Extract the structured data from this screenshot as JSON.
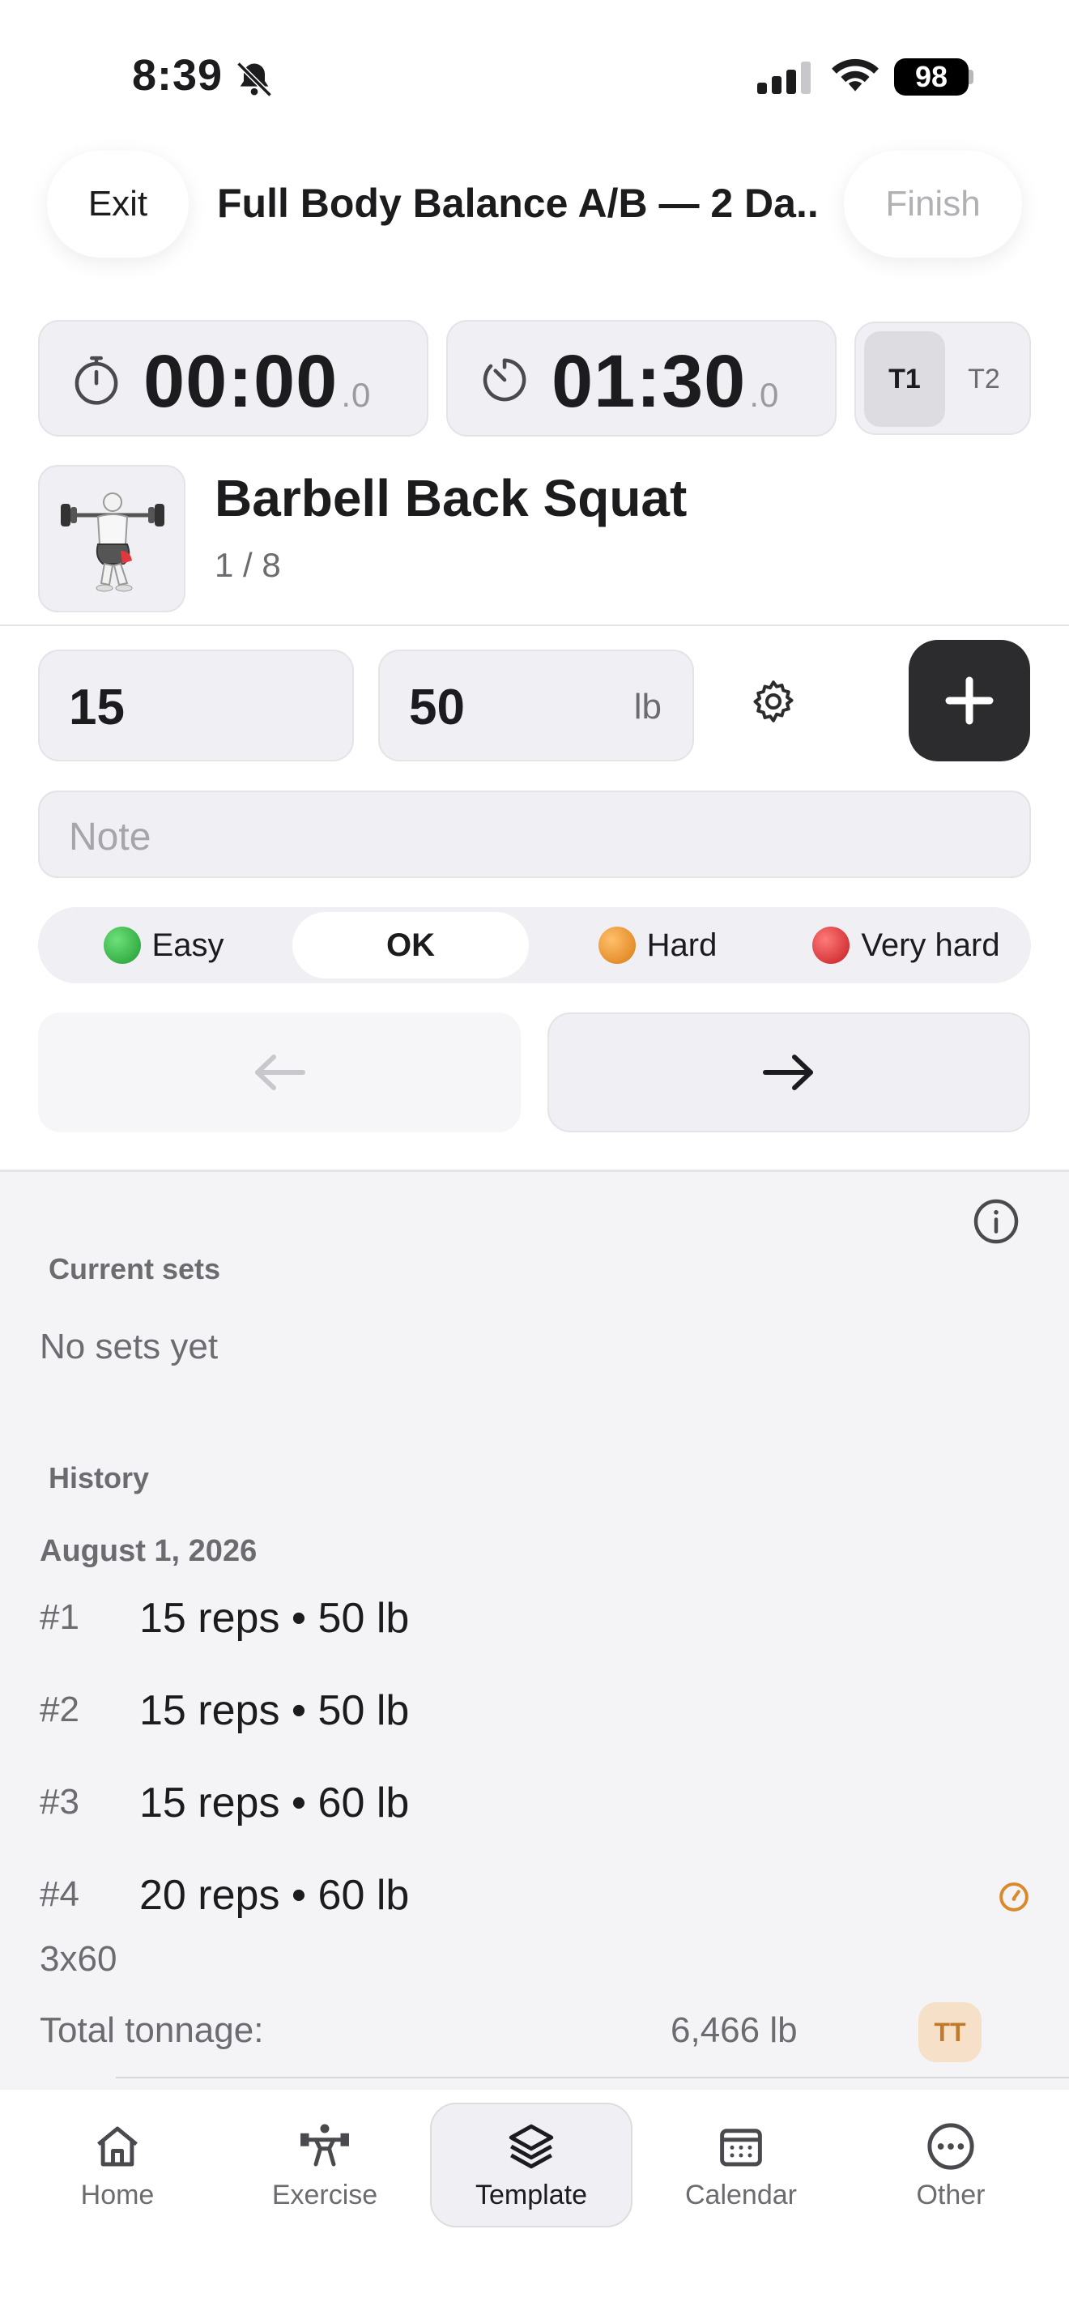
{
  "status": {
    "time": "8:39",
    "battery": "98"
  },
  "header": {
    "exit_label": "Exit",
    "title": "Full Body Balance A/B — 2 Da...",
    "finish_label": "Finish"
  },
  "timers": {
    "elapsed_main": "00:00",
    "elapsed_frac": ".0",
    "rest_main": "01:30",
    "rest_frac": ".0",
    "tabs": [
      "T1",
      "T2"
    ],
    "active_tab": "T1"
  },
  "exercise": {
    "name": "Barbell Back Squat",
    "progress": "1 / 8",
    "icon": "squat-figure-icon"
  },
  "inputs": {
    "reps_value": "15",
    "weight_value": "50",
    "weight_unit": "lb",
    "note_placeholder": "Note"
  },
  "difficulty": {
    "options": [
      {
        "label": "Easy",
        "color": "#34c759"
      },
      {
        "label": "OK",
        "color": ""
      },
      {
        "label": "Hard",
        "color": "#f0932b"
      },
      {
        "label": "Very hard",
        "color": "#e0262a"
      }
    ],
    "selected": "OK"
  },
  "current_sets": {
    "label": "Current sets",
    "empty_text": "No sets yet"
  },
  "history": {
    "label": "History",
    "date": "August 1, 2026",
    "sets": [
      {
        "num": "#1",
        "text": "15 reps • 50 lb"
      },
      {
        "num": "#2",
        "text": "15 reps • 50 lb"
      },
      {
        "num": "#3",
        "text": "15 reps • 60 lb"
      },
      {
        "num": "#4",
        "text": "20 reps • 60 lb"
      }
    ],
    "note": "3x60",
    "tonnage_label": "Total tonnage:",
    "tonnage_value": "6,466 lb",
    "tonnage_badge": "TT"
  },
  "tabbar": {
    "items": [
      {
        "label": "Home",
        "icon": "home-icon"
      },
      {
        "label": "Exercise",
        "icon": "exercise-icon"
      },
      {
        "label": "Template",
        "icon": "layers-icon"
      },
      {
        "label": "Calendar",
        "icon": "calendar-icon"
      },
      {
        "label": "Other",
        "icon": "more-icon"
      }
    ],
    "active": "Template"
  },
  "colors": {
    "accent_dark": "#2c2c2e",
    "badge_orange": "#c07a2c",
    "surface": "#efeff4"
  }
}
